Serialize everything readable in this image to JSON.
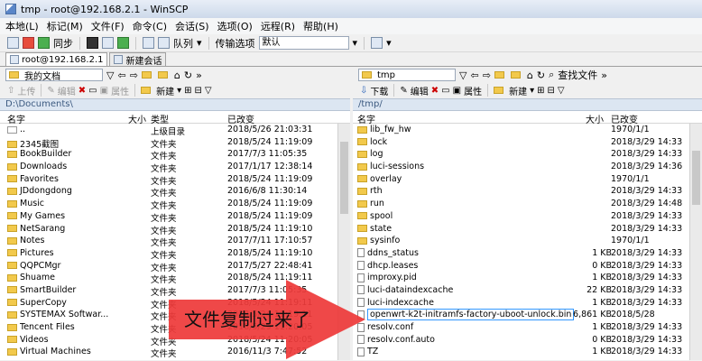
{
  "window": {
    "title": "tmp - root@192.168.2.1 - WinSCP"
  },
  "menu": [
    "本地(L)",
    "标记(M)",
    "文件(F)",
    "命令(C)",
    "会话(S)",
    "选项(O)",
    "远程(R)",
    "帮助(H)"
  ],
  "toolbar": {
    "sync": "同步",
    "queue": "队列",
    "transfer_label": "传输选项",
    "transfer_value": "默认"
  },
  "tabs": [
    {
      "label": "root@192.168.2.1"
    },
    {
      "label": "新建会话"
    }
  ],
  "left": {
    "folder": "我的文档",
    "actions": {
      "upload": "上传",
      "edit": "编辑",
      "properties": "属性",
      "new": "新建"
    },
    "path": "D:\\Documents\\",
    "columns": {
      "name": "名字",
      "size": "大小",
      "type": "类型",
      "modified": "已改变"
    },
    "rows": [
      {
        "name": "..",
        "size": "",
        "type": "上级目录",
        "modified": "2018/5/26 21:03:31",
        "kind": "up"
      },
      {
        "name": "2345截图",
        "size": "",
        "type": "文件夹",
        "modified": "2018/5/24 11:19:09",
        "kind": "folder"
      },
      {
        "name": "BookBuilder",
        "size": "",
        "type": "文件夹",
        "modified": "2017/7/3 11:05:35",
        "kind": "folder"
      },
      {
        "name": "Downloads",
        "size": "",
        "type": "文件夹",
        "modified": "2017/1/17 12:38:14",
        "kind": "folder"
      },
      {
        "name": "Favorites",
        "size": "",
        "type": "文件夹",
        "modified": "2018/5/24 11:19:09",
        "kind": "folder"
      },
      {
        "name": "JDdongdong",
        "size": "",
        "type": "文件夹",
        "modified": "2016/6/8 11:30:14",
        "kind": "folder"
      },
      {
        "name": "Music",
        "size": "",
        "type": "文件夹",
        "modified": "2018/5/24 11:19:09",
        "kind": "folder"
      },
      {
        "name": "My Games",
        "size": "",
        "type": "文件夹",
        "modified": "2018/5/24 11:19:09",
        "kind": "folder"
      },
      {
        "name": "NetSarang",
        "size": "",
        "type": "文件夹",
        "modified": "2018/5/24 11:19:10",
        "kind": "folder"
      },
      {
        "name": "Notes",
        "size": "",
        "type": "文件夹",
        "modified": "2017/7/11 17:10:57",
        "kind": "folder"
      },
      {
        "name": "Pictures",
        "size": "",
        "type": "文件夹",
        "modified": "2018/5/24 11:19:10",
        "kind": "folder"
      },
      {
        "name": "QQPCMgr",
        "size": "",
        "type": "文件夹",
        "modified": "2017/5/27 22:48:41",
        "kind": "folder"
      },
      {
        "name": "Shuame",
        "size": "",
        "type": "文件夹",
        "modified": "2018/5/24 11:19:11",
        "kind": "folder"
      },
      {
        "name": "SmartBuilder",
        "size": "",
        "type": "文件夹",
        "modified": "2017/7/3 11:05:35",
        "kind": "folder"
      },
      {
        "name": "SuperCopy",
        "size": "",
        "type": "文件夹",
        "modified": "2018/5/24 11:19:11",
        "kind": "folder"
      },
      {
        "name": "SYSTEMAX Softwar...",
        "size": "",
        "type": "文件夹",
        "modified": "2018/5/24 11:19:11",
        "kind": "folder"
      },
      {
        "name": "Tencent Files",
        "size": "",
        "type": "文件夹",
        "modified": "2018/5/29 11:20:05",
        "kind": "folder"
      },
      {
        "name": "Videos",
        "size": "",
        "type": "文件夹",
        "modified": "2018/5/24 11:20:05",
        "kind": "folder"
      },
      {
        "name": "Virtual Machines",
        "size": "",
        "type": "文件夹",
        "modified": "2016/11/3 7:47:52",
        "kind": "folder"
      }
    ]
  },
  "right": {
    "folder": "tmp",
    "find": "查找文件",
    "actions": {
      "download": "下载",
      "edit": "编辑",
      "properties": "属性",
      "new": "新建"
    },
    "path": "/tmp/",
    "columns": {
      "name": "名字",
      "size": "大小",
      "modified": "已改变"
    },
    "rows": [
      {
        "name": "lib_fw_hw",
        "size": "",
        "modified": "1970/1/1",
        "kind": "folder"
      },
      {
        "name": "lock",
        "size": "",
        "modified": "2018/3/29 14:33",
        "kind": "folder"
      },
      {
        "name": "log",
        "size": "",
        "modified": "2018/3/29 14:33",
        "kind": "folder"
      },
      {
        "name": "luci-sessions",
        "size": "",
        "modified": "2018/3/29 14:36",
        "kind": "folder"
      },
      {
        "name": "overlay",
        "size": "",
        "modified": "1970/1/1",
        "kind": "folder"
      },
      {
        "name": "rth",
        "size": "",
        "modified": "2018/3/29 14:33",
        "kind": "folder"
      },
      {
        "name": "run",
        "size": "",
        "modified": "2018/3/29 14:48",
        "kind": "folder"
      },
      {
        "name": "spool",
        "size": "",
        "modified": "2018/3/29 14:33",
        "kind": "folder"
      },
      {
        "name": "state",
        "size": "",
        "modified": "2018/3/29 14:33",
        "kind": "folder"
      },
      {
        "name": "sysinfo",
        "size": "",
        "modified": "1970/1/1",
        "kind": "folder"
      },
      {
        "name": "ddns_status",
        "size": "1 KB",
        "modified": "2018/3/29 14:33",
        "kind": "file"
      },
      {
        "name": "dhcp.leases",
        "size": "0 KB",
        "modified": "2018/3/29 14:33",
        "kind": "file"
      },
      {
        "name": "improxy.pid",
        "size": "1 KB",
        "modified": "2018/3/29 14:33",
        "kind": "file"
      },
      {
        "name": "luci-dataindexcache",
        "size": "22 KB",
        "modified": "2018/3/29 14:33",
        "kind": "file"
      },
      {
        "name": "luci-indexcache",
        "size": "1 KB",
        "modified": "2018/3/29 14:33",
        "kind": "file"
      },
      {
        "name": "openwrt-k2t-initramfs-factory-uboot-unlock.bin",
        "size": "6,861 KB",
        "modified": "2018/5/28",
        "kind": "file",
        "selected": true
      },
      {
        "name": "resolv.conf",
        "size": "1 KB",
        "modified": "2018/3/29 14:33",
        "kind": "file"
      },
      {
        "name": "resolv.conf.auto",
        "size": "0 KB",
        "modified": "2018/3/29 14:33",
        "kind": "file"
      },
      {
        "name": "TZ",
        "size": "1 KB",
        "modified": "2018/3/29 14:33",
        "kind": "file"
      }
    ]
  },
  "annotation": {
    "text": "文件复制过来了",
    "color": "#ee3b3b"
  }
}
